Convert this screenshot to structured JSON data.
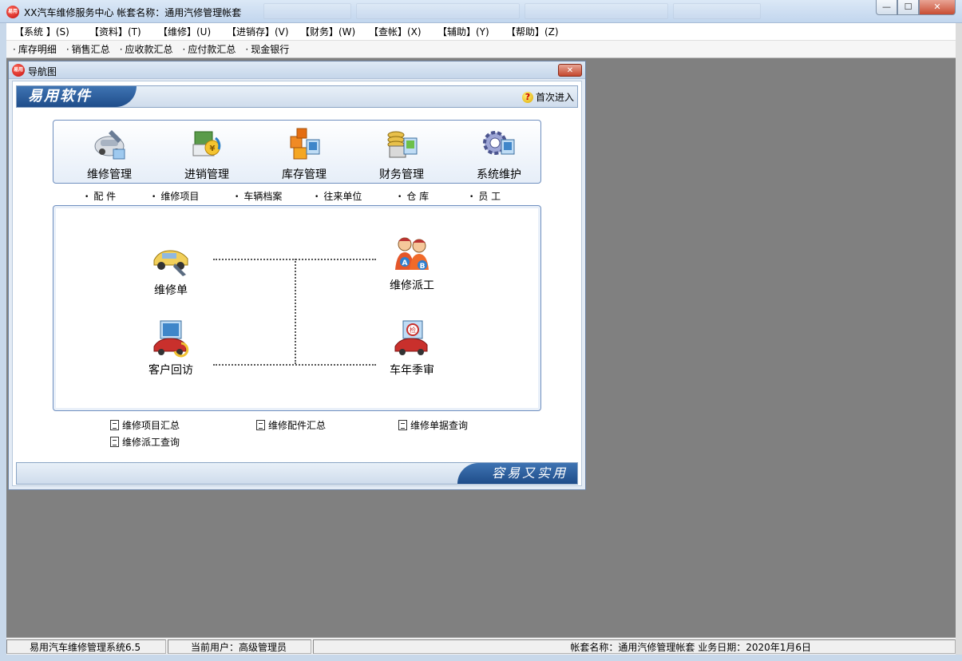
{
  "app": {
    "title": "XX汽车维修服务中心    帐套名称：通用汽修管理帐套",
    "icon_text": "易用"
  },
  "window_controls": {
    "minimize": "—",
    "maximize": "☐",
    "close": "✕"
  },
  "menubar": {
    "items": [
      {
        "label": "【系统 】(S)"
      },
      {
        "label": "【资料】(T)"
      },
      {
        "label": "【维修】(U)"
      },
      {
        "label": "【进销存】(V)"
      },
      {
        "label": "【财务】(W)"
      },
      {
        "label": "【查帐】(X)"
      },
      {
        "label": "【辅助】(Y)"
      },
      {
        "label": "【帮助】(Z)"
      }
    ]
  },
  "quickbar": {
    "items": [
      {
        "label": "库存明细"
      },
      {
        "label": "销售汇总"
      },
      {
        "label": "应收款汇总"
      },
      {
        "label": "应付款汇总"
      },
      {
        "label": "现金银行"
      }
    ]
  },
  "navigator": {
    "title": "导航图",
    "close": "✕",
    "banner_logo": "易用软件",
    "help_link": "首次进入",
    "help_icon": "?",
    "modules": [
      {
        "label": "维修管理",
        "icon": "repair-icon"
      },
      {
        "label": "进销管理",
        "icon": "purchase-sales-icon"
      },
      {
        "label": "库存管理",
        "icon": "inventory-icon"
      },
      {
        "label": "财务管理",
        "icon": "finance-icon"
      },
      {
        "label": "系统维护",
        "icon": "settings-gear-icon"
      }
    ],
    "sub_links": [
      {
        "label": "配 件"
      },
      {
        "label": "维修项目"
      },
      {
        "label": "车辆档案"
      },
      {
        "label": "往来单位"
      },
      {
        "label": "仓  库"
      },
      {
        "label": "员  工"
      }
    ],
    "workflow": [
      {
        "label": "维修单",
        "icon": "repair-order-car-icon"
      },
      {
        "label": "维修派工",
        "icon": "mechanics-dispatch-icon"
      },
      {
        "label": "客户回访",
        "icon": "customer-visit-icon"
      },
      {
        "label": "车年季审",
        "icon": "annual-inspection-icon"
      }
    ],
    "workflow_badges": {
      "a": "A",
      "b": "B",
      "inspect": "检"
    },
    "reports": [
      {
        "label": "维修项目汇总"
      },
      {
        "label": "维修配件汇总"
      },
      {
        "label": "维修单据查询"
      },
      {
        "label": "维修派工查询"
      }
    ],
    "footer_slogan": "容易又实用"
  },
  "statusbar": {
    "app_version": "易用汽车维修管理系统6.5",
    "current_user": "当前用户：高级管理员",
    "account_info": "帐套名称：通用汽修管理帐套    业务日期：2020年1月6日"
  }
}
